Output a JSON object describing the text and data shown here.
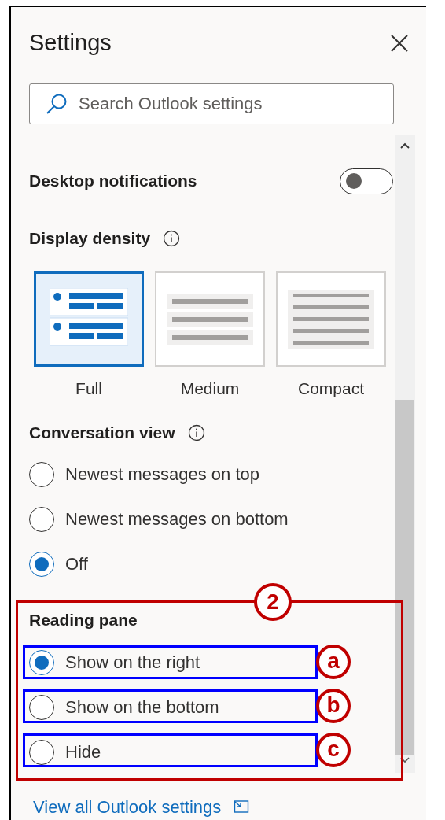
{
  "title": "Settings",
  "search": {
    "placeholder": "Search Outlook settings"
  },
  "desktop_notifications": {
    "label": "Desktop notifications",
    "on": false
  },
  "display_density": {
    "label": "Display density",
    "options": [
      {
        "label": "Full",
        "kind": "full",
        "selected": true
      },
      {
        "label": "Medium",
        "kind": "medium",
        "selected": false
      },
      {
        "label": "Compact",
        "kind": "compact",
        "selected": false
      }
    ]
  },
  "conversation_view": {
    "label": "Conversation view",
    "options": [
      {
        "label": "Newest messages on top",
        "selected": false
      },
      {
        "label": "Newest messages on bottom",
        "selected": false
      },
      {
        "label": "Off",
        "selected": true
      }
    ]
  },
  "reading_pane": {
    "label": "Reading pane",
    "options": [
      {
        "label": "Show on the right",
        "selected": true,
        "marker": "a"
      },
      {
        "label": "Show on the bottom",
        "selected": false,
        "marker": "b"
      },
      {
        "label": "Hide",
        "selected": false,
        "marker": "c"
      }
    ]
  },
  "annotation": {
    "callout": "2"
  },
  "link": "View all Outlook settings"
}
